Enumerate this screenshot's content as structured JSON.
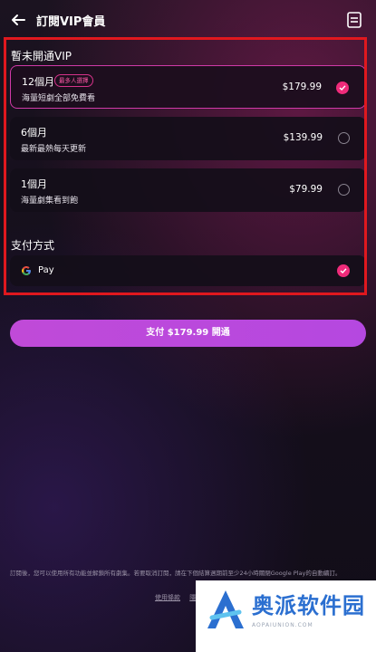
{
  "header": {
    "title": "訂閱VIP會員",
    "back_icon": "back-arrow-icon",
    "menu_icon": "document-icon"
  },
  "vip_section": {
    "title": "暫未開通VIP",
    "plans": [
      {
        "name": "12個月",
        "badge": "最多人選擇",
        "desc": "海量短劇全部免費看",
        "price": "$179.99",
        "selected": true
      },
      {
        "name": "6個月",
        "desc": "最新最熱每天更新",
        "price": "$139.99",
        "selected": false
      },
      {
        "name": "1個月",
        "desc": "海量劇集看到飽",
        "price": "$79.99",
        "selected": false
      }
    ]
  },
  "payment_section": {
    "title": "支付方式",
    "method": {
      "label": "Pay",
      "icon": "google-g-icon",
      "selected": true
    }
  },
  "pay_button": {
    "label": "支付 $179.99 開通"
  },
  "footer": {
    "note": "訂閱後，您可以使用所有功能並解鎖所有劇集。若要取消訂閱，請在下個結算週期前至少24小時關閉Google Play的自動續訂。",
    "links": [
      "使用條款",
      "隱私政策"
    ]
  },
  "watermark": {
    "text": "奥派软件园",
    "sub": "AOPAIUNION.COM"
  },
  "colors": {
    "accent": "#ef2b7a",
    "button": "#c04ad8",
    "highlight": "#e0181e"
  }
}
